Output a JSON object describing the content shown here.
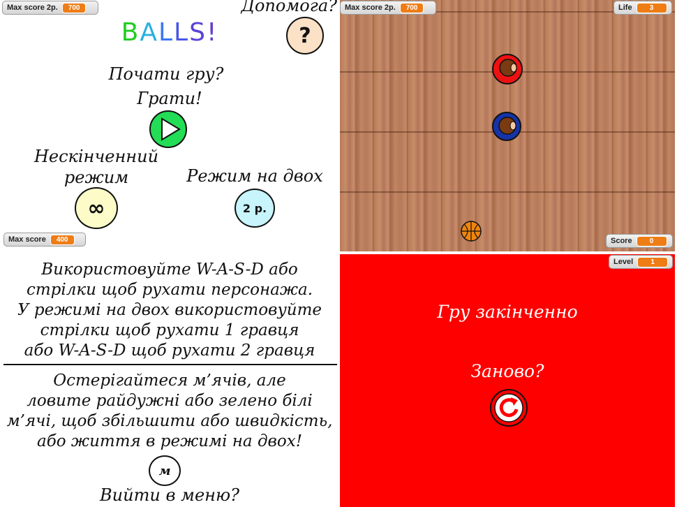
{
  "menu": {
    "title_letters": [
      "B",
      "A",
      "L",
      "L",
      "S",
      "!"
    ],
    "title_colors": [
      "#22cc22",
      "#2ab0e0",
      "#3a78f0",
      "#4a56e6",
      "#5a44d8",
      "#6a40c8"
    ],
    "help_label": "Допомога?",
    "help_glyph": "?",
    "start_question": "Почати гру?",
    "play_label": "Грати!",
    "endless_label_line1": "Нескінченний",
    "endless_label_line2": "режим",
    "endless_glyph": "∞",
    "twoplayer_label": "Режим на двох",
    "twoplayer_glyph": "2 р.",
    "monitor_max2p": {
      "label": "Max score 2p.",
      "value": "700"
    },
    "monitor_max": {
      "label": "Max score",
      "value": "400"
    }
  },
  "game": {
    "monitor_max2p": {
      "label": "Max score 2p.",
      "value": "700"
    },
    "monitor_life": {
      "label": "Life",
      "value": "3"
    },
    "monitor_score": {
      "label": "Score",
      "value": "0"
    },
    "player1_color": "#ee1111",
    "player2_color": "#1633a8"
  },
  "help": {
    "lines_top": [
      "Використовуйте W-A-S-D або",
      "стрілки щоб рухати персонажа.",
      "У режимі на двох використовуйте",
      "стрілки щоб рухати 1 гравця",
      "або W-A-S-D щоб рухати 2 гравця"
    ],
    "lines_bottom": [
      "Остерігайтеся м’ячів, але",
      "ловите райдужні або зелено білі",
      "м’ячі, щоб збільшити або швидкість,",
      "або життя в режимі на двох!"
    ],
    "menu_glyph": "м",
    "back_to_menu": "Вийти в меню?"
  },
  "gameover": {
    "title": "Гру закінченно",
    "retry_label": "Заново?",
    "monitor_level": {
      "label": "Level",
      "value": "1"
    }
  }
}
